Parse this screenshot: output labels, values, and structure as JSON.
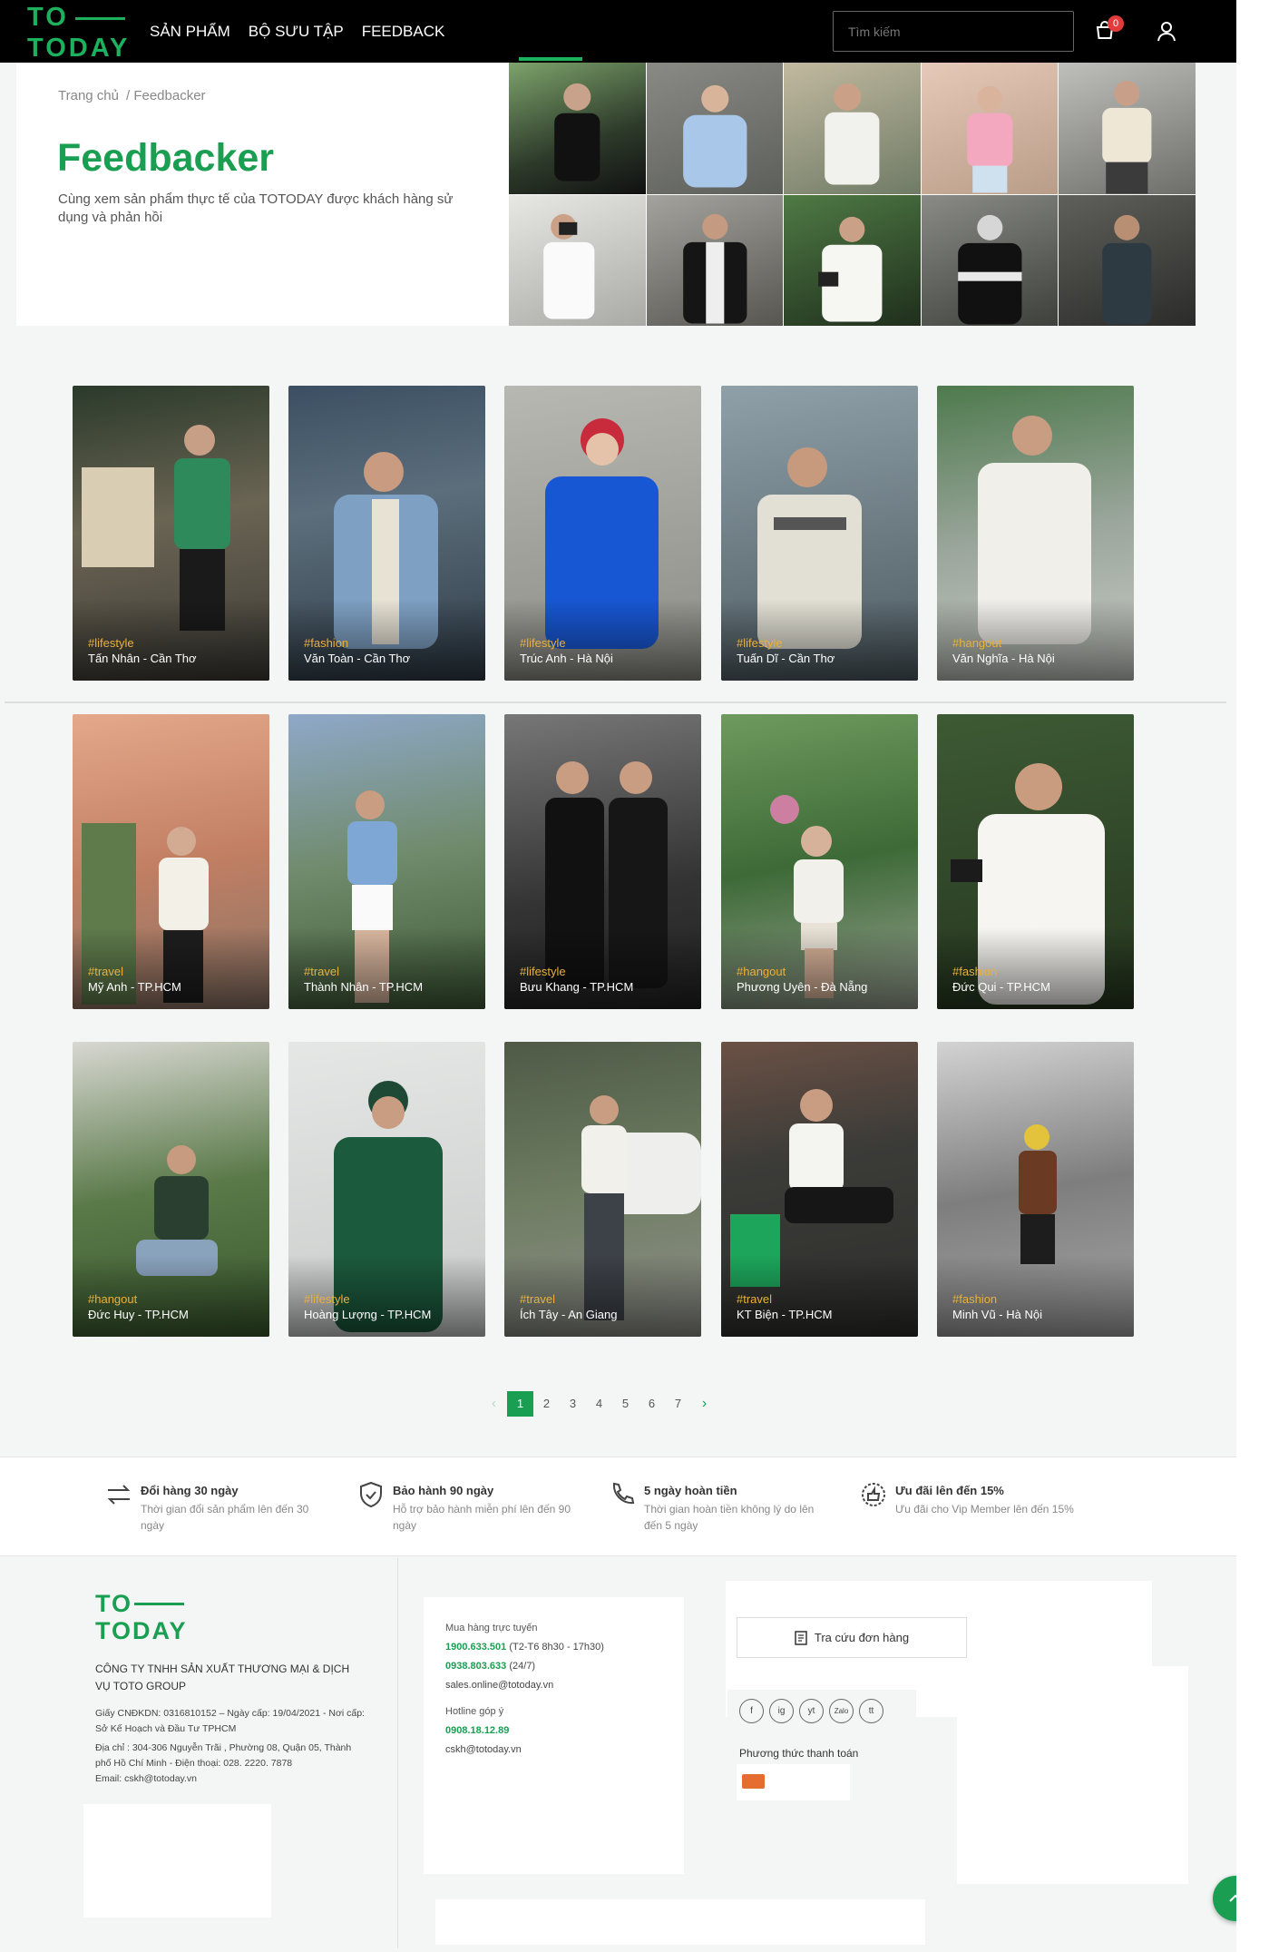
{
  "header": {
    "logo_line1": "TO",
    "logo_line2": "TODAY",
    "nav": [
      "SẢN PHẨM",
      "BỘ SƯU TẬP",
      "FEEDBACK"
    ],
    "search_placeholder": "Tìm kiếm",
    "cart_count": "0",
    "icons": {
      "cart": "cart-icon",
      "user": "user-icon",
      "search": "search-icon"
    }
  },
  "hero": {
    "breadcrumb": [
      "Trang chủ",
      "/ Feedbacker"
    ],
    "title": "Feedbacker",
    "description": "Cùng xem sản phẩm thực tế của TOTODAY được khách hàng sử dụng và phản hồi"
  },
  "cards": [
    {
      "tag": "#lifestyle",
      "name": "Tấn Nhân - Cần Thơ"
    },
    {
      "tag": "#fashion",
      "name": "Văn Toàn - Cần Thơ"
    },
    {
      "tag": "#lifestyle",
      "name": "Trúc Anh - Hà Nội"
    },
    {
      "tag": "#lifestyle",
      "name": "Tuấn Dĩ - Cần Thơ"
    },
    {
      "tag": "#hangout",
      "name": "Văn Nghĩa - Hà Nội"
    },
    {
      "tag": "#travel",
      "name": "Mỹ Anh - TP.HCM"
    },
    {
      "tag": "#travel",
      "name": "Thành Nhân - TP.HCM"
    },
    {
      "tag": "#lifestyle",
      "name": "Bưu Khang - TP.HCM"
    },
    {
      "tag": "#hangout",
      "name": "Phương Uyên - Đà Nẵng"
    },
    {
      "tag": "#fashion",
      "name": "Đức Qui - TP.HCM"
    },
    {
      "tag": "#hangout",
      "name": "Đức Huy - TP.HCM"
    },
    {
      "tag": "#lifestyle",
      "name": "Hoàng Lượng - TP.HCM"
    },
    {
      "tag": "#travel",
      "name": "Ích Tây - An Giang"
    },
    {
      "tag": "#travel",
      "name": "KT Biện - TP.HCM"
    },
    {
      "tag": "#fashion",
      "name": "Minh Vũ - Hà Nội"
    }
  ],
  "pagination": {
    "prev": "‹",
    "pages": [
      "1",
      "2",
      "3",
      "4",
      "5",
      "6",
      "7"
    ],
    "active": "1",
    "next": "›"
  },
  "benefits": [
    {
      "icon": "exchange-icon",
      "title": "Đổi hàng 30 ngày",
      "desc": "Thời gian đổi sản phẩm lên đến 30 ngày"
    },
    {
      "icon": "shield-icon",
      "title": "Bảo hành 90 ngày",
      "desc": "Hỗ trợ bảo hành miễn phí lên đến 90 ngày"
    },
    {
      "icon": "phone-icon",
      "title": "5 ngày hoàn tiền",
      "desc": "Thời gian hoàn tiền không lý do lên đến 5 ngày"
    },
    {
      "icon": "like-badge-icon",
      "title": "Ưu đãi lên đến 15%",
      "desc": "Ưu đãi cho Vip Member lên đến 15%"
    }
  ],
  "footer": {
    "logo_line1": "TO",
    "logo_line2": "TODAY",
    "company": "CÔNG TY TNHH SẢN XUẤT THƯƠNG MẠI & DỊCH VỤ TOTO GROUP",
    "license": "Giấy CNĐKDN: 0316810152 – Ngày cấp: 19/04/2021 - Nơi cấp: Sở Kế Hoạch và Đầu Tư TPHCM",
    "address": "Địa chỉ : 304-306 Nguyễn Trãi , Phường 08, Quận 05, Thành phố Hồ Chí Minh - Điện thoại: 028. 2220. 7878",
    "email": "Email: cskh@totoday.vn",
    "online_label": "Mua hàng trực tuyến",
    "phone1": "1900.633.501",
    "phone1_note": "(T2-T6 8h30 - 17h30)",
    "phone2": "0938.803.633",
    "phone2_note": "(24/7)",
    "sales_email": "sales.online@totoday.vn",
    "feedback_label": "Hotline góp ý",
    "hotline": "0908.18.12.89",
    "cskh_email": "cskh@totoday.vn",
    "lookup": "Tra cứu đơn hàng",
    "socials": [
      "f",
      "ig",
      "yt",
      "Zalo",
      "tt"
    ],
    "payment_title": "Phương thức thanh toán"
  },
  "colors": {
    "brand": "#1a9f52",
    "tag": "#e9b13c",
    "badge": "#e23b3b"
  }
}
